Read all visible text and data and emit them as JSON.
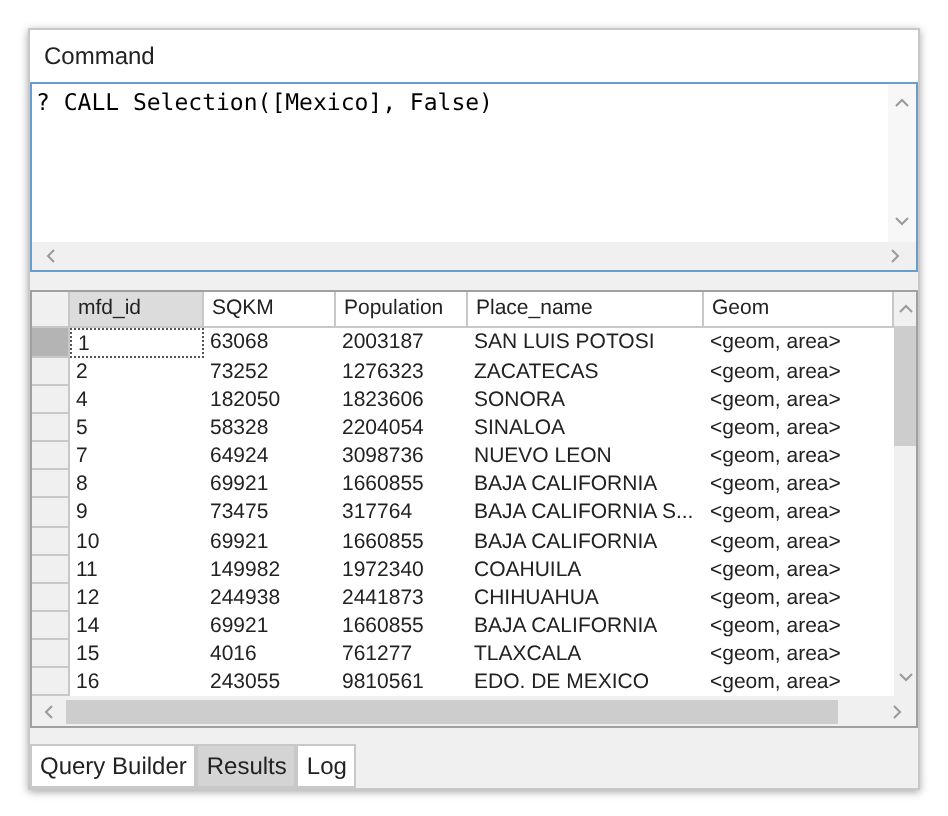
{
  "window": {
    "title": "Command"
  },
  "command": {
    "value": "? CALL Selection([Mexico], False)"
  },
  "table": {
    "columns": [
      {
        "label": "mfd_id",
        "selected": true
      },
      {
        "label": "SQKM",
        "selected": false
      },
      {
        "label": "Population",
        "selected": false
      },
      {
        "label": "Place_name",
        "selected": false
      },
      {
        "label": "Geom",
        "selected": false
      }
    ],
    "rows": [
      {
        "selected": true,
        "cells": [
          "1",
          "63068",
          "2003187",
          "SAN LUIS POTOSI",
          "<geom, area>"
        ]
      },
      {
        "selected": false,
        "cells": [
          "2",
          "73252",
          "1276323",
          "ZACATECAS",
          "<geom, area>"
        ]
      },
      {
        "selected": false,
        "cells": [
          "4",
          "182050",
          "1823606",
          "SONORA",
          "<geom, area>"
        ]
      },
      {
        "selected": false,
        "cells": [
          "5",
          "58328",
          "2204054",
          "SINALOA",
          "<geom, area>"
        ]
      },
      {
        "selected": false,
        "cells": [
          "7",
          "64924",
          "3098736",
          "NUEVO LEON",
          "<geom, area>"
        ]
      },
      {
        "selected": false,
        "cells": [
          "8",
          "69921",
          "1660855",
          "BAJA CALIFORNIA",
          "<geom, area>"
        ]
      },
      {
        "selected": false,
        "cells": [
          "9",
          "73475",
          "317764",
          "BAJA CALIFORNIA S...",
          "<geom, area>"
        ]
      },
      {
        "selected": false,
        "cells": [
          "10",
          "69921",
          "1660855",
          "BAJA CALIFORNIA",
          "<geom, area>"
        ]
      },
      {
        "selected": false,
        "cells": [
          "11",
          "149982",
          "1972340",
          "COAHUILA",
          "<geom, area>"
        ]
      },
      {
        "selected": false,
        "cells": [
          "12",
          "244938",
          "2441873",
          "CHIHUAHUA",
          "<geom, area>"
        ]
      },
      {
        "selected": false,
        "cells": [
          "14",
          "69921",
          "1660855",
          "BAJA CALIFORNIA",
          "<geom, area>"
        ]
      },
      {
        "selected": false,
        "cells": [
          "15",
          "4016",
          "761277",
          "TLAXCALA",
          "<geom, area>"
        ]
      },
      {
        "selected": false,
        "cells": [
          "16",
          "243055",
          "9810561",
          "EDO. DE MEXICO",
          "<geom, area>"
        ]
      }
    ]
  },
  "tabs": [
    {
      "label": "Query Builder",
      "selected": false
    },
    {
      "label": "Results",
      "selected": true
    },
    {
      "label": "Log",
      "selected": false
    }
  ]
}
